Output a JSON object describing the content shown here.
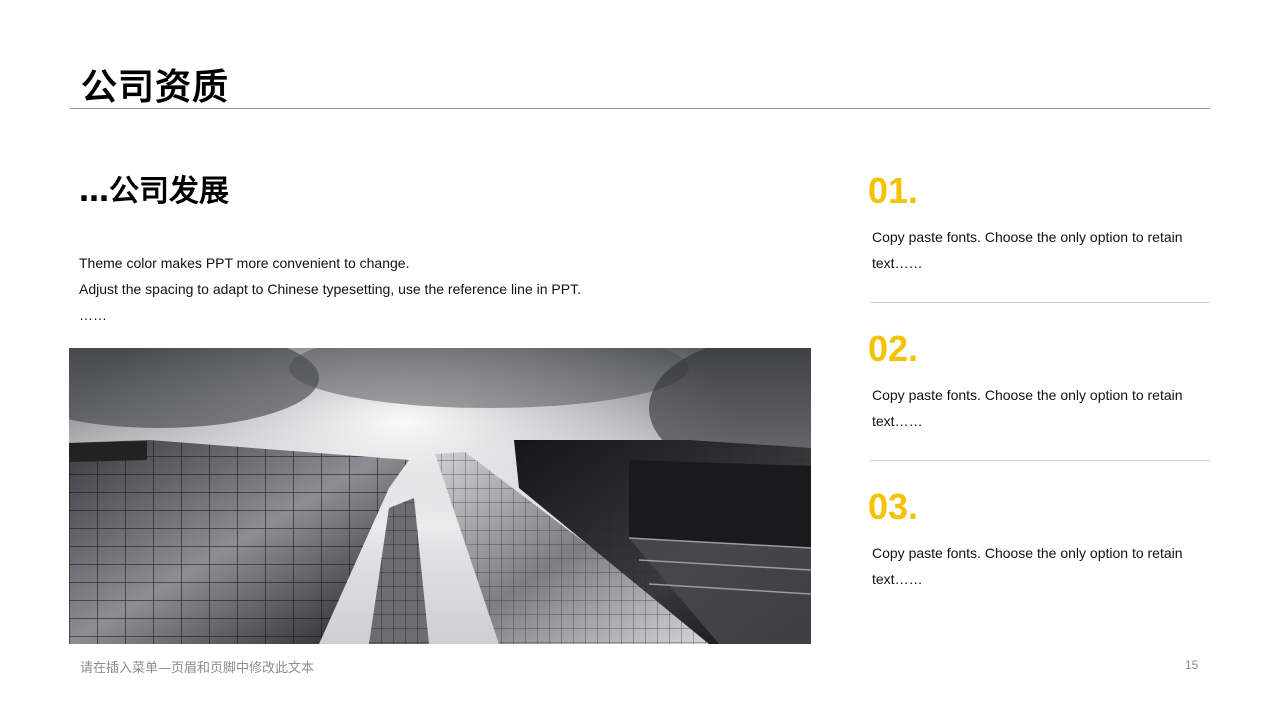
{
  "slide": {
    "title": "公司资质",
    "subtitle": "…公司发展",
    "body_lines": [
      "Theme color makes PPT more convenient  to change.",
      "Adjust  the  spacing  to  adapt  to Chinese  typesetting,  use  the  reference  line  in  PPT.",
      "……"
    ],
    "photo": {
      "description_icon": "building-photo"
    },
    "items": [
      {
        "number": "01.",
        "text": "Copy paste fonts. Choose the only option to retain text……"
      },
      {
        "number": "02.",
        "text": "Copy paste fonts. Choose the only option to retain text……"
      },
      {
        "number": "03.",
        "text": "Copy paste fonts. Choose the only option to retain text……"
      }
    ],
    "footer_text": "请在插入菜单—页眉和页脚中修改此文本",
    "page_number": "15",
    "accent_color": "#f5c200"
  }
}
